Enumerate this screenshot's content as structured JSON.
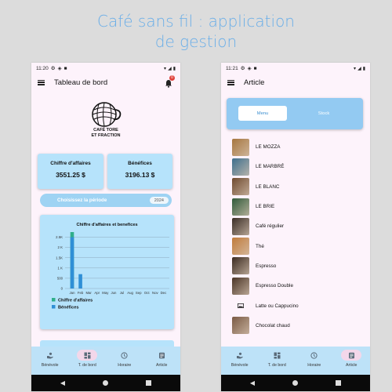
{
  "headline": {
    "line1": "Café sans fil : application",
    "line2": "de gestion"
  },
  "colors": {
    "accent": "#6aaee8",
    "card": "#b6e3fb",
    "nav": "#bde2f8",
    "green": "#2fae8a",
    "blue": "#2f8fd6"
  },
  "left": {
    "status": {
      "time": "11:20"
    },
    "appbar": {
      "title": "Tableau de bord",
      "notification_count": "0"
    },
    "logo": {
      "line1": "CAFÉ TORE",
      "line2": "ET FRACTION"
    },
    "kpis": [
      {
        "label": "Chiffre d'affaires",
        "value": "3551.25 $"
      },
      {
        "label": "Bénéfices",
        "value": "3196.13 $"
      }
    ],
    "period": {
      "label": "Choisissez la période",
      "year": "2024"
    }
  },
  "chart_data": {
    "type": "bar",
    "title": "Chiffre d'affaires et benefices",
    "categories": [
      "Jan",
      "Feb",
      "Mar",
      "Apr",
      "May",
      "Jun",
      "Jul",
      "Aug",
      "Sep",
      "Oct",
      "Nov",
      "Dec"
    ],
    "ytick_labels": [
      "0",
      "500",
      "1 K",
      "1.5K",
      "2 K",
      "2.5K"
    ],
    "yticks": [
      0,
      500,
      1000,
      1500,
      2000,
      2500
    ],
    "ylim": [
      0,
      2750
    ],
    "series": [
      {
        "name": "Chiffre d'affaires",
        "color": "#2fae8a",
        "values": [
          2750,
          0,
          0,
          0,
          0,
          0,
          0,
          0,
          0,
          0,
          0,
          0
        ]
      },
      {
        "name": "Bénéfices",
        "color": "#2f8fd6",
        "values": [
          2500,
          700,
          0,
          0,
          0,
          0,
          0,
          0,
          0,
          0,
          0,
          0
        ]
      }
    ],
    "legend": "bottom-left",
    "grid": true
  },
  "nav_items": [
    {
      "label": "Bénévole",
      "icon": "volunteer-icon"
    },
    {
      "label": "T. de bord",
      "icon": "dashboard-icon"
    },
    {
      "label": "Horaire",
      "icon": "clock-icon"
    },
    {
      "label": "Article",
      "icon": "article-icon"
    }
  ],
  "right": {
    "status": {
      "time": "11:21"
    },
    "appbar": {
      "title": "Article"
    },
    "toggle": {
      "menu": "Menu",
      "stock": "Stock"
    },
    "items": [
      {
        "label": "LE MOZZA",
        "thumb": "#a6763f"
      },
      {
        "label": "LE MARBRÉ",
        "thumb": "#3d6e8c"
      },
      {
        "label": "LE BLANC",
        "thumb": "#6f4a2f"
      },
      {
        "label": "LE BRIE",
        "thumb": "#2f5a3a"
      },
      {
        "label": "Café régulier",
        "thumb": "#3a2d26"
      },
      {
        "label": "Thé",
        "thumb": "#c07a3a"
      },
      {
        "label": "Espresso",
        "thumb": "#3b2a20"
      },
      {
        "label": "Espresso Double",
        "thumb": "#4a3426"
      },
      {
        "label": "Latte ou Cappucino",
        "thumb": "none"
      },
      {
        "label": "Chocolat chaud",
        "thumb": "#7a5a44"
      }
    ]
  }
}
